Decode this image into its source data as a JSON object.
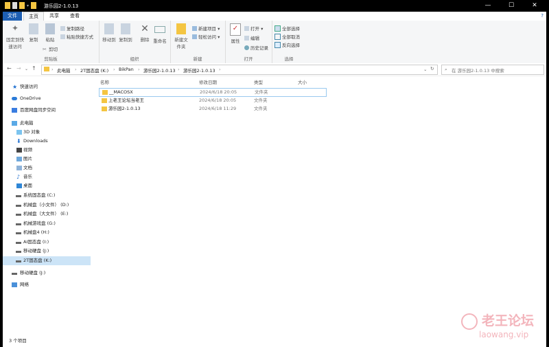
{
  "window": {
    "title": "游乐园2-1.0.13",
    "controls": {
      "minimize": "—",
      "maximize": "☐",
      "close": "✕"
    }
  },
  "ribbon_tabs": [
    "文件",
    "主页",
    "共享",
    "查看"
  ],
  "ribbon": {
    "clipboard": {
      "pin": "固定到快速访问",
      "copy": "复制",
      "paste": "粘贴",
      "copy_path": "复制路径",
      "paste_shortcut": "粘贴快捷方式",
      "cut": "剪切",
      "label": "剪贴板"
    },
    "organize": {
      "move_to": "移动到",
      "copy_to": "复制到",
      "delete": "删除",
      "rename": "重命名",
      "label": "组织"
    },
    "new": {
      "new_folder": "新建文件夹",
      "new_item": "新建项目 ▾",
      "easy_access": "轻松访问 ▾",
      "label": "新建"
    },
    "open": {
      "properties": "属性",
      "open": "打开 ▾",
      "edit": "编辑",
      "history": "历史记录",
      "label": "打开"
    },
    "select": {
      "select_all": "全部选择",
      "select_none": "全部取消",
      "invert": "反向选择",
      "label": "选择"
    }
  },
  "address": {
    "crumbs": [
      "此电脑",
      "2T固态盘 (K:)",
      "BikPan",
      "游乐园2-1.0.13",
      "游乐园2-1.0.13"
    ],
    "search_placeholder": "在 游乐园2-1.0.13 中搜索"
  },
  "nav": {
    "quick_access": "快速访问",
    "onedrive": "OneDrive",
    "baidu": "百度网盘同步空间",
    "this_pc": "此电脑",
    "pc_items": [
      "3D 对象",
      "Downloads",
      "视频",
      "图片",
      "文档",
      "音乐",
      "桌面"
    ],
    "drives": [
      "系统固态盘 (C:)",
      "机械盘（小文件） (D:)",
      "机械盘（大文件） (E:)",
      "机械游戏盘 (G:)",
      "机械盘4 (H:)",
      "AI固态盘 (I:)",
      "移动硬盘 (J:)",
      "2T固态盘 (K:)"
    ],
    "removable": "移动硬盘 (J:)",
    "network": "网络"
  },
  "columns": {
    "name": "名称",
    "date": "修改日期",
    "type": "类型",
    "size": "大小"
  },
  "files": [
    {
      "name": "__MACOSX",
      "date": "2024/6/18 20:05",
      "type": "文件夹"
    },
    {
      "name": "上老王论坛当老王",
      "date": "2024/6/18 20:05",
      "type": "文件夹"
    },
    {
      "name": "游乐园2-1.0.13",
      "date": "2024/6/18 11:29",
      "type": "文件夹"
    }
  ],
  "status": {
    "count": "3 个项目"
  },
  "watermark": {
    "line1": "老王论坛",
    "line2": "laowang.vip"
  },
  "colors": {
    "accent": "#1e5fb3",
    "folder": "#f4c542",
    "selection": "#cce4f7"
  }
}
